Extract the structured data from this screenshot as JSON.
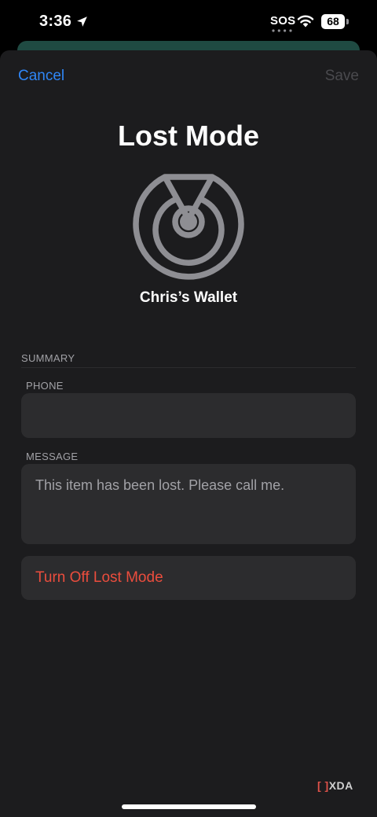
{
  "status_bar": {
    "time": "3:36",
    "carrier_status": "SOS",
    "battery_level": "68",
    "icons": [
      "location-arrow-icon",
      "wifi-icon",
      "battery-icon"
    ]
  },
  "nav": {
    "cancel_label": "Cancel",
    "save_label": "Save"
  },
  "header": {
    "title": "Lost Mode",
    "icon": "lost-mode-radar-icon",
    "item_name": "Chris’s Wallet"
  },
  "form": {
    "section_title": "SUMMARY",
    "phone_label": "PHONE",
    "phone_value": "",
    "message_label": "MESSAGE",
    "message_value": "This item has been lost. Please call me."
  },
  "actions": {
    "turn_off_label": "Turn Off Lost Mode"
  },
  "watermark": {
    "text": "XDA"
  },
  "colors": {
    "accent": "#2f86f6",
    "destructive": "#eb4d3d",
    "sheet_background": "#1c1c1e",
    "field_background": "#2c2c2e"
  }
}
